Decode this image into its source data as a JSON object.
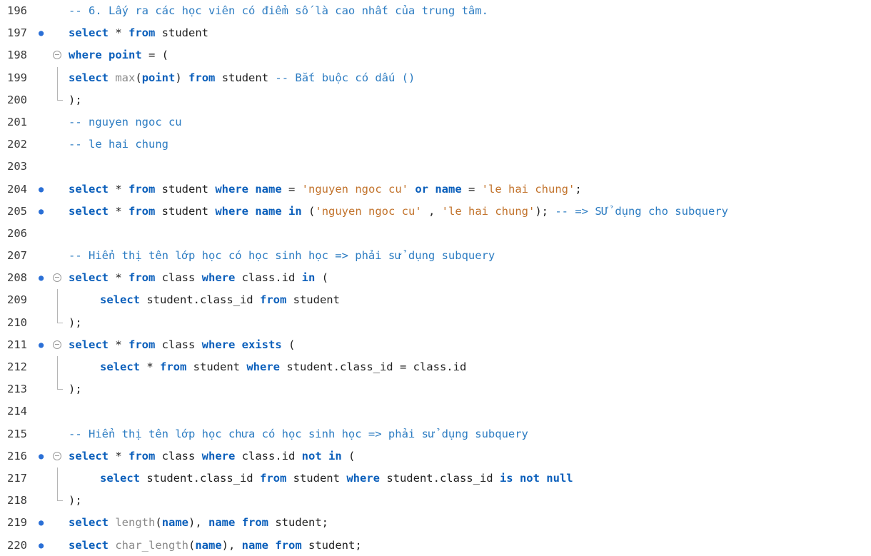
{
  "lines": [
    {
      "n": "196",
      "parts": [
        [
          "cm",
          "-- 6. Lấy ra các học viên có điểm số là cao nhất của trung tâm."
        ]
      ]
    },
    {
      "n": "197",
      "parts": [
        [
          "kw",
          "select"
        ],
        [
          "op",
          " * "
        ],
        [
          "kw",
          "from"
        ],
        [
          "id",
          " student"
        ]
      ]
    },
    {
      "n": "198",
      "parts": [
        [
          "kw",
          "where"
        ],
        [
          "id",
          " "
        ],
        [
          "kw",
          "point"
        ],
        [
          "op",
          " = ("
        ]
      ]
    },
    {
      "n": "199",
      "parts": [
        [
          "kw",
          "select"
        ],
        [
          "id",
          " "
        ],
        [
          "fn",
          "max"
        ],
        [
          "op",
          "("
        ],
        [
          "kw",
          "point"
        ],
        [
          "op",
          ")"
        ],
        [
          "id",
          " "
        ],
        [
          "kw",
          "from"
        ],
        [
          "id",
          " student "
        ],
        [
          "cm",
          "-- Bắt buộc có dấu ()"
        ]
      ]
    },
    {
      "n": "200",
      "parts": [
        [
          "op",
          ");"
        ]
      ]
    },
    {
      "n": "201",
      "parts": [
        [
          "cm",
          "-- nguyen ngoc cu"
        ]
      ]
    },
    {
      "n": "202",
      "parts": [
        [
          "cm",
          "-- le hai chung"
        ]
      ]
    },
    {
      "n": "203",
      "parts": []
    },
    {
      "n": "204",
      "parts": [
        [
          "kw",
          "select"
        ],
        [
          "op",
          " * "
        ],
        [
          "kw",
          "from"
        ],
        [
          "id",
          " student "
        ],
        [
          "kw",
          "where"
        ],
        [
          "id",
          " "
        ],
        [
          "kw",
          "name"
        ],
        [
          "op",
          " = "
        ],
        [
          "st",
          "'nguyen ngoc cu'"
        ],
        [
          "id",
          " "
        ],
        [
          "kw",
          "or"
        ],
        [
          "id",
          " "
        ],
        [
          "kw",
          "name"
        ],
        [
          "op",
          " = "
        ],
        [
          "st",
          "'le hai chung'"
        ],
        [
          "op",
          ";"
        ]
      ]
    },
    {
      "n": "205",
      "parts": [
        [
          "kw",
          "select"
        ],
        [
          "op",
          " * "
        ],
        [
          "kw",
          "from"
        ],
        [
          "id",
          " student "
        ],
        [
          "kw",
          "where"
        ],
        [
          "id",
          " "
        ],
        [
          "kw",
          "name"
        ],
        [
          "id",
          " "
        ],
        [
          "kw",
          "in"
        ],
        [
          "op",
          " ("
        ],
        [
          "st",
          "'nguyen ngoc cu'"
        ],
        [
          "op",
          " , "
        ],
        [
          "st",
          "'le hai chung'"
        ],
        [
          "op",
          "); "
        ],
        [
          "cm",
          "-- => SỬ dụng cho subquery"
        ]
      ]
    },
    {
      "n": "206",
      "parts": []
    },
    {
      "n": "207",
      "parts": [
        [
          "cm",
          "-- Hiển thị tên lớp học có học sinh học => phải sử dụng subquery"
        ]
      ]
    },
    {
      "n": "208",
      "parts": [
        [
          "kw",
          "select"
        ],
        [
          "op",
          " * "
        ],
        [
          "kw",
          "from"
        ],
        [
          "id",
          " class "
        ],
        [
          "kw",
          "where"
        ],
        [
          "id",
          " class.id "
        ],
        [
          "kw",
          "in"
        ],
        [
          "op",
          " ("
        ]
      ]
    },
    {
      "n": "209",
      "parts": [
        [
          "kw",
          "select"
        ],
        [
          "id",
          " student.class_id "
        ],
        [
          "kw",
          "from"
        ],
        [
          "id",
          " student"
        ]
      ]
    },
    {
      "n": "210",
      "parts": [
        [
          "op",
          ");"
        ]
      ]
    },
    {
      "n": "211",
      "parts": [
        [
          "kw",
          "select"
        ],
        [
          "op",
          " * "
        ],
        [
          "kw",
          "from"
        ],
        [
          "id",
          " class "
        ],
        [
          "kw",
          "where"
        ],
        [
          "id",
          " "
        ],
        [
          "kw",
          "exists"
        ],
        [
          "op",
          " ("
        ]
      ]
    },
    {
      "n": "212",
      "parts": [
        [
          "kw",
          "select"
        ],
        [
          "op",
          " * "
        ],
        [
          "kw",
          "from"
        ],
        [
          "id",
          " student "
        ],
        [
          "kw",
          "where"
        ],
        [
          "id",
          " student.class_id = class.id"
        ]
      ]
    },
    {
      "n": "213",
      "parts": [
        [
          "op",
          ");"
        ]
      ]
    },
    {
      "n": "214",
      "parts": []
    },
    {
      "n": "215",
      "parts": [
        [
          "cm",
          "-- Hiển thị tên lớp học chưa có học sinh học => phải sử dụng subquery"
        ]
      ]
    },
    {
      "n": "216",
      "parts": [
        [
          "kw",
          "select"
        ],
        [
          "op",
          " * "
        ],
        [
          "kw",
          "from"
        ],
        [
          "id",
          " class "
        ],
        [
          "kw",
          "where"
        ],
        [
          "id",
          " class.id "
        ],
        [
          "kw",
          "not in"
        ],
        [
          "op",
          " ("
        ]
      ]
    },
    {
      "n": "217",
      "parts": [
        [
          "kw",
          "select"
        ],
        [
          "id",
          " student.class_id "
        ],
        [
          "kw",
          "from"
        ],
        [
          "id",
          " student "
        ],
        [
          "kw",
          "where"
        ],
        [
          "id",
          " student.class_id "
        ],
        [
          "kw",
          "is not null"
        ]
      ]
    },
    {
      "n": "218",
      "parts": [
        [
          "op",
          ");"
        ]
      ]
    },
    {
      "n": "219",
      "parts": [
        [
          "kw",
          "select"
        ],
        [
          "id",
          " "
        ],
        [
          "fn",
          "length"
        ],
        [
          "op",
          "("
        ],
        [
          "kw",
          "name"
        ],
        [
          "op",
          "), "
        ],
        [
          "kw",
          "name"
        ],
        [
          "id",
          " "
        ],
        [
          "kw",
          "from"
        ],
        [
          "id",
          " student;"
        ]
      ]
    },
    {
      "n": "220",
      "parts": [
        [
          "kw",
          "select"
        ],
        [
          "id",
          " "
        ],
        [
          "fn",
          "char_length"
        ],
        [
          "op",
          "("
        ],
        [
          "kw",
          "name"
        ],
        [
          "op",
          "), "
        ],
        [
          "kw",
          "name"
        ],
        [
          "id",
          " "
        ],
        [
          "kw",
          "from"
        ],
        [
          "id",
          " student;"
        ]
      ]
    }
  ],
  "colors": {
    "keyword": "#0b5fbb",
    "comment": "#2c7cc2",
    "string": "#c2732c",
    "function": "#8a8a8a",
    "statement_marker": "#2a6fd6"
  },
  "gutter_icons": {
    "statement_marker": "dot-icon",
    "fold_marker": "fold-collapse-icon"
  }
}
